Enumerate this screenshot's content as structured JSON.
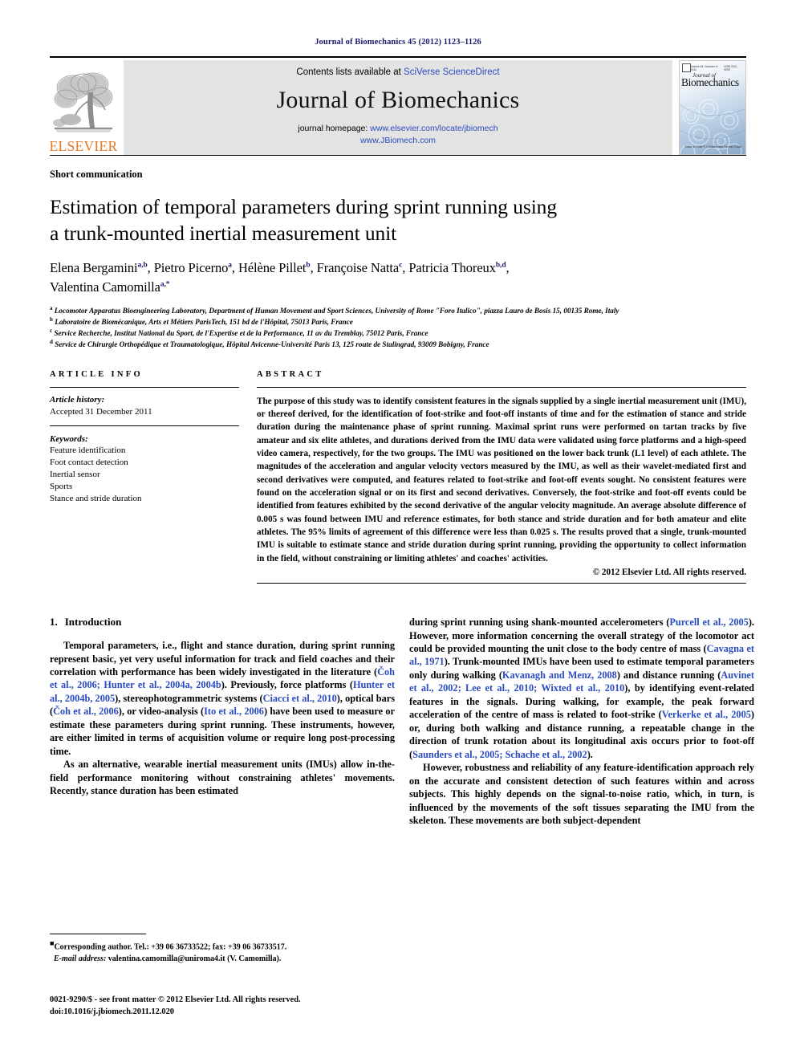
{
  "running_head": "Journal of Biomechanics 45 (2012) 1123–1126",
  "masthead": {
    "contents_prefix": "Contents lists available at ",
    "contents_link": "SciVerse ScienceDirect",
    "journal_name": "Journal of Biomechanics",
    "homepage_label": "journal homepage: ",
    "homepage_url": "www.elsevier.com/locate/jbiomech",
    "homepage_url2": "www.JBiomech.com",
    "publisher_name": "ELSEVIER",
    "cover": {
      "journal_of": "Journal of",
      "title": "Biomechanics",
      "volume_line": "Volume 45 / Number 6 / 2012",
      "issn_line": "ISSN 0021-9290",
      "editors": "Editor-in-Chief\nR.I. Huiskes and\nFarshid Guilak"
    }
  },
  "article": {
    "type": "Short communication",
    "title_line1": "Estimation of temporal parameters during sprint running using",
    "title_line2": "a trunk-mounted inertial measurement unit",
    "authors": [
      {
        "name": "Elena Bergamini",
        "sup": "a,b",
        "sep": ", "
      },
      {
        "name": "Pietro Picerno",
        "sup": "a",
        "sep": ", "
      },
      {
        "name": "Hélène Pillet",
        "sup": "b",
        "sep": ", "
      },
      {
        "name": "Françoise Natta",
        "sup": "c",
        "sep": ", "
      },
      {
        "name": "Patricia Thoreux",
        "sup": "b,d",
        "sep": ","
      },
      {
        "name": "Valentina Camomilla",
        "sup": "a,*",
        "sep": ""
      }
    ],
    "affiliations": [
      {
        "mark": "a",
        "text": "Locomotor Apparatus Bioengineering Laboratory, Department of Human Movement and Sport Sciences, University of Rome \"Foro Italico\", piazza Lauro de Bosis 15, 00135 Rome, Italy"
      },
      {
        "mark": "b",
        "text": "Laboratoire de Biomécanique, Arts et Métiers ParisTech, 151 bd de l'Hôpital, 75013 Paris, France"
      },
      {
        "mark": "c",
        "text": "Service Recherche, Institut National du Sport, de l'Expertise et de la Performance, 11 av du Tremblay, 75012 Paris, France"
      },
      {
        "mark": "d",
        "text": "Service de Chirurgie Orthopédique et Traumatologique, Hôpital Avicenne-Université Paris 13, 125 route de Stalingrad, 93009 Bobigny, France"
      }
    ]
  },
  "article_info": {
    "heading": "ARTICLE INFO",
    "history_label": "Article history:",
    "history_value": "Accepted 31 December 2011",
    "keywords_label": "Keywords:",
    "keywords": [
      "Feature identification",
      "Foot contact detection",
      "Inertial sensor",
      "Sports",
      "Stance and stride duration"
    ]
  },
  "abstract": {
    "heading": "ABSTRACT",
    "text": "The purpose of this study was to identify consistent features in the signals supplied by a single inertial measurement unit (IMU), or thereof derived, for the identification of foot-strike and foot-off instants of time and for the estimation of stance and stride duration during the maintenance phase of sprint running. Maximal sprint runs were performed on tartan tracks by five amateur and six elite athletes, and durations derived from the IMU data were validated using force platforms and a high-speed video camera, respectively, for the two groups. The IMU was positioned on the lower back trunk (L1 level) of each athlete. The magnitudes of the acceleration and angular velocity vectors measured by the IMU, as well as their wavelet-mediated first and second derivatives were computed, and features related to foot-strike and foot-off events sought. No consistent features were found on the acceleration signal or on its first and second derivatives. Conversely, the foot-strike and foot-off events could be identified from features exhibited by the second derivative of the angular velocity magnitude. An average absolute difference of 0.005 s was found between IMU and reference estimates, for both stance and stride duration and for both amateur and elite athletes. The 95% limits of agreement of this difference were less than 0.025 s. The results proved that a single, trunk-mounted IMU is suitable to estimate stance and stride duration during sprint running, providing the opportunity to collect information in the field, without constraining or limiting athletes' and coaches' activities.",
    "copyright": "© 2012 Elsevier Ltd. All rights reserved."
  },
  "introduction": {
    "number": "1.",
    "title": "Introduction",
    "left_paragraphs": [
      "Temporal parameters, i.e., flight and stance duration, during sprint running represent basic, yet very useful information for track and field coaches and their correlation with performance has been widely investigated in the literature (Čoh et al., 2006; Hunter et al., 2004a, 2004b). Previously, force platforms (Hunter et al., 2004b, 2005), stereophotogrammetric systems (Ciacci et al., 2010), optical bars (Čoh et al., 2006), or video-analysis (Ito et al., 2006) have been used to measure or estimate these parameters during sprint running. These instruments, however, are either limited in terms of acquisition volume or require long post-processing time.",
      "As an alternative, wearable inertial measurement units (IMUs) allow in-the-field performance monitoring without constraining athletes' movements. Recently, stance duration has been estimated"
    ],
    "right_paragraphs": [
      "during sprint running using shank-mounted accelerometers (Purcell et al., 2005). However, more information concerning the overall strategy of the locomotor act could be provided mounting the unit close to the body centre of mass (Cavagna et al., 1971). Trunk-mounted IMUs have been used to estimate temporal parameters only during walking (Kavanagh and Menz, 2008) and distance running (Auvinet et al., 2002; Lee et al., 2010; Wixted et al., 2010), by identifying event-related features in the signals. During walking, for example, the peak forward acceleration of the centre of mass is related to foot-strike (Verkerke et al., 2005) or, during both walking and distance running, a repeatable change in the direction of trunk rotation about its longitudinal axis occurs prior to foot-off (Saunders et al., 2005; Schache et al., 2002).",
      "However, robustness and reliability of any feature-identification approach rely on the accurate and consistent detection of such features within and across subjects. This highly depends on the signal-to-noise ratio, which, in turn, is influenced by the movements of the soft tissues separating the IMU from the skeleton. These movements are both subject-dependent"
    ]
  },
  "footnotes": {
    "corresponding": "Corresponding author. Tel.: +39 06 36733522; fax: +39 06 36733517.",
    "email_label": "E-mail address:",
    "email_value": "valentina.camomilla@uniroma4.it (V. Camomilla)."
  },
  "imprint": {
    "line1": "0021-9290/$ - see front matter © 2012 Elsevier Ltd. All rights reserved.",
    "line2": "doi:10.1016/j.jbiomech.2011.12.020"
  },
  "colors": {
    "link": "#2a4bc0",
    "running_head": "#1a1a6e",
    "elsevier_orange": "#E87722",
    "band_gray": "#e3e3e3"
  }
}
